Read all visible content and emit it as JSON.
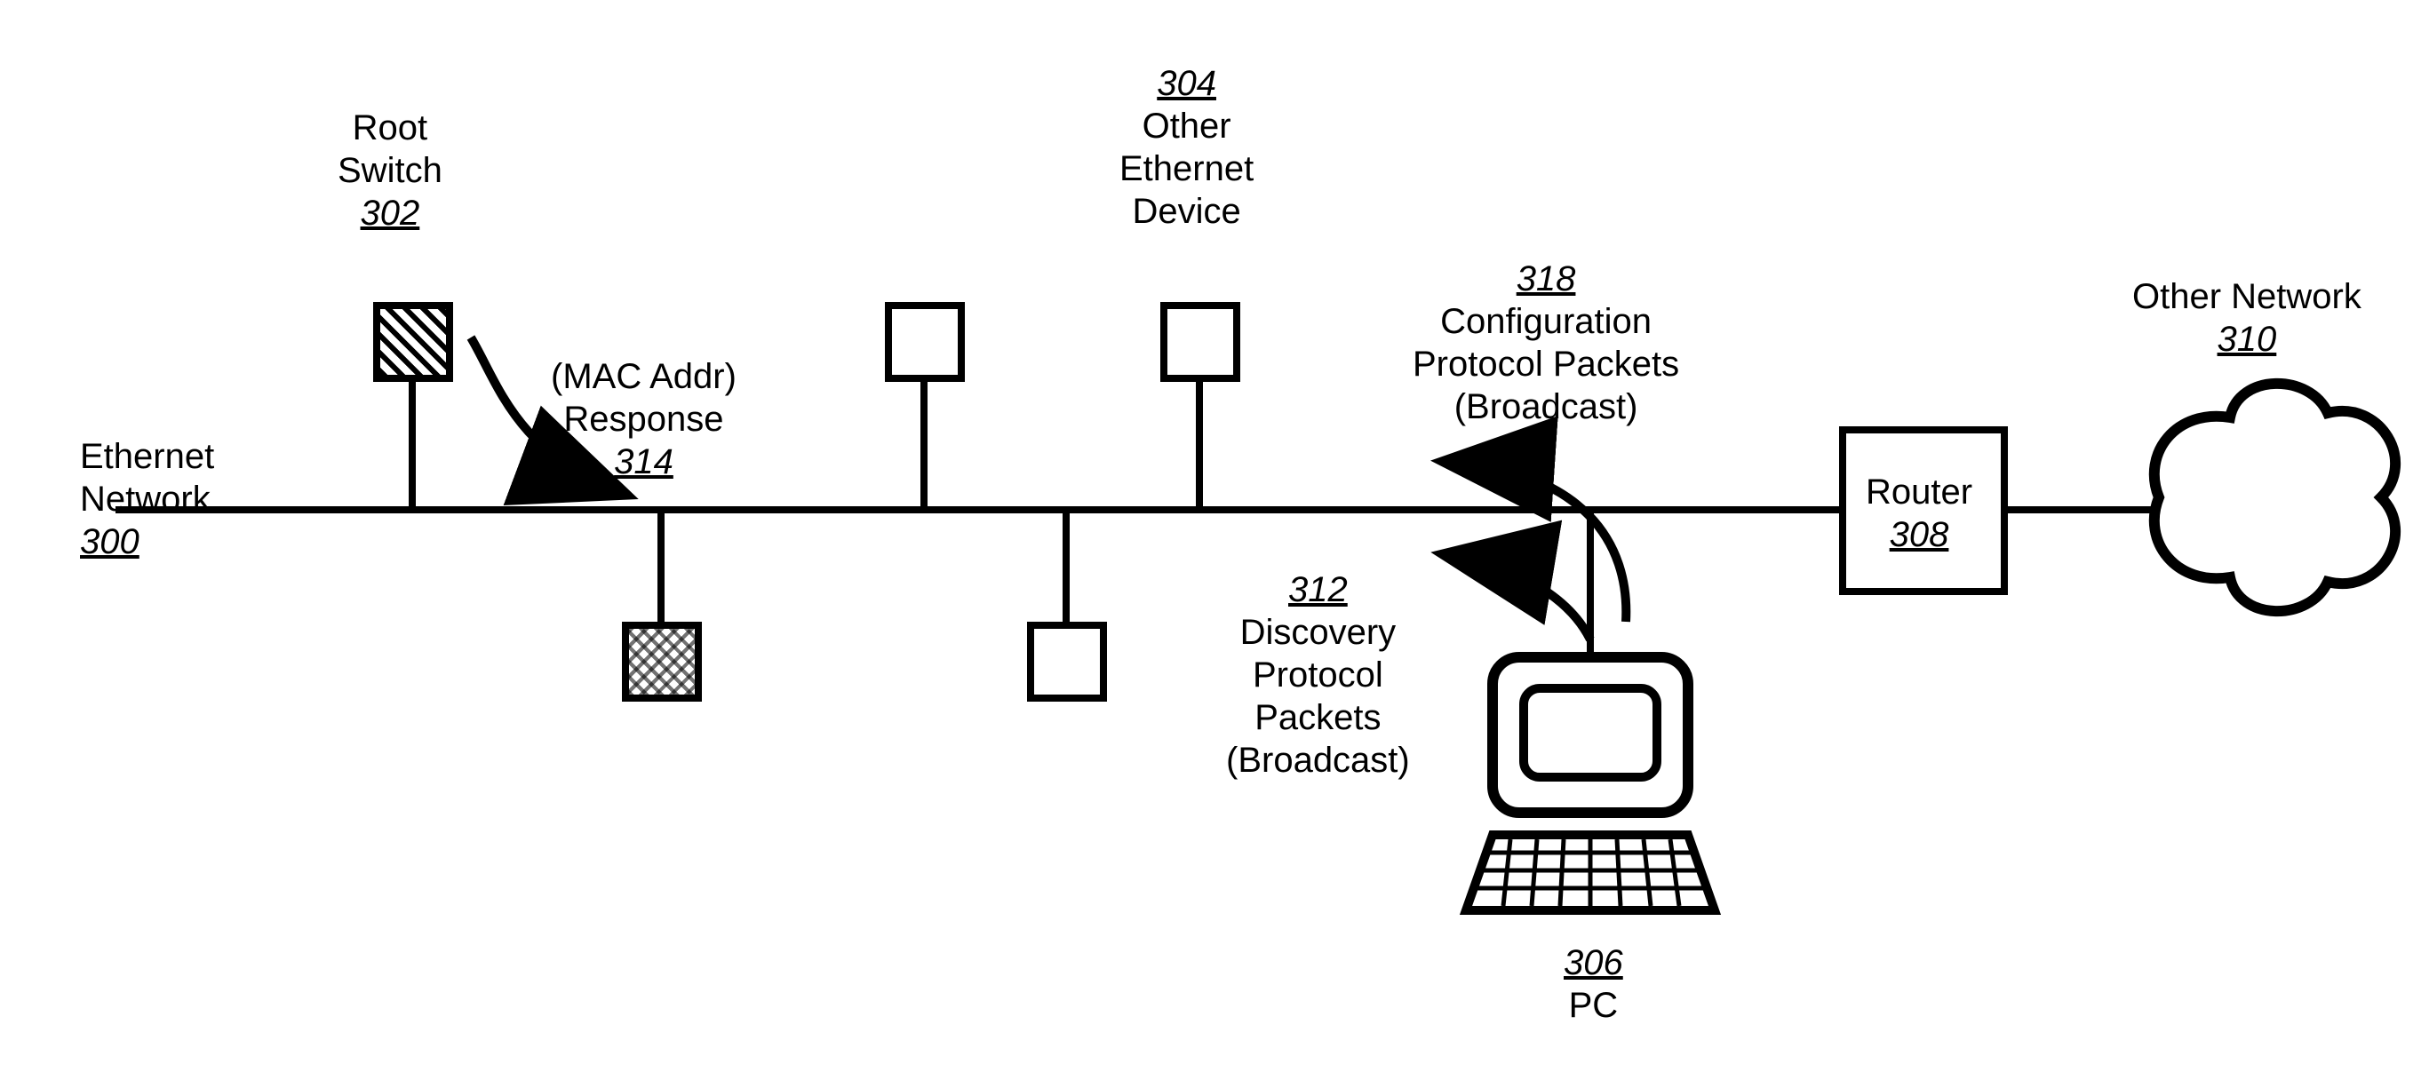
{
  "labels": {
    "ethernet_network": {
      "line1": "Ethernet",
      "line2": "Network",
      "ref": "300"
    },
    "root_switch": {
      "line1": "Root",
      "line2": "Switch",
      "ref": "302"
    },
    "other_eth_device": {
      "ref": "304",
      "line1": "Other",
      "line2": "Ethernet",
      "line3": "Device"
    },
    "pc": {
      "ref": "306",
      "line1": "PC"
    },
    "router": {
      "line1": "Router",
      "ref": "308"
    },
    "other_network": {
      "line1": "Other Network",
      "ref": "310"
    },
    "discovery": {
      "ref": "312",
      "line1": "Discovery",
      "line2": "Protocol",
      "line3": "Packets",
      "line4": "(Broadcast)"
    },
    "response": {
      "line1": "(MAC Addr)",
      "line2": "Response",
      "ref": "314"
    },
    "config": {
      "ref": "318",
      "line1": "Configuration",
      "line2": "Protocol Packets",
      "line3": "(Broadcast)"
    }
  }
}
